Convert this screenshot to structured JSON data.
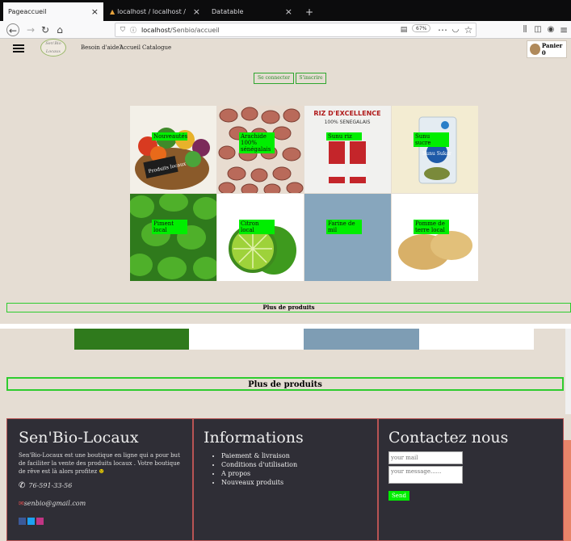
{
  "browser": {
    "tabs": [
      {
        "title": "Pageaccueil",
        "active": true
      },
      {
        "title": "localhost / localhost / Senbio / ...",
        "active": false
      },
      {
        "title": "Datatable",
        "active": false
      }
    ],
    "new_tab": "+",
    "url_host": "localhost",
    "url_path": "/Senbio/accueil",
    "zoom": "67%"
  },
  "header": {
    "logo_text": "Sen'Bio Locaux",
    "nav": [
      "Besoin d'aide?",
      "Accueil",
      "Catalogue"
    ],
    "cart_label": "Panier 0",
    "login_label": "Se connecter",
    "signup_label": "S'inscrire"
  },
  "products": [
    {
      "label": "Nouveautés"
    },
    {
      "label": "Arachide 100% sénégalais"
    },
    {
      "label": "Sunu riz"
    },
    {
      "label": "Sunu sucre"
    },
    {
      "label": "Piment local"
    },
    {
      "label": "Citron local"
    },
    {
      "label": "Farine de mil"
    },
    {
      "label": "Pomme de terre local"
    }
  ],
  "product_image_text": {
    "basket_sign": "Produits locaux",
    "rice_title": "RIZ D'EXCELLENCE",
    "rice_sub": "100% SENEGALAIS",
    "sugar_brand": "Sunu Sukar"
  },
  "more_products": "Plus de produits",
  "footer": {
    "brand": "Sen'Bio-Locaux",
    "description": "Sen'Bio-Locaux est une boutique en ligne qui a pour but de faciliter la vente des produits locaux . Votre boutique de rêve est là alors profitez",
    "phone": "76-591-33-56",
    "email": "senbio@gmail.com",
    "info_title": "Informations",
    "info_links": [
      "Paiement & livraison",
      "Conditions d'utilisation",
      "A propos",
      "Nouveaux produits"
    ],
    "contact_title": "Contactez nous",
    "mail_placeholder": "your mail",
    "message_placeholder": "your message......",
    "send_label": "Send"
  },
  "colors": {
    "accent": "#00ee00",
    "footer_bg": "#2f2e36",
    "page_bg": "#e5ddd3",
    "footer_border": "#b85454"
  }
}
